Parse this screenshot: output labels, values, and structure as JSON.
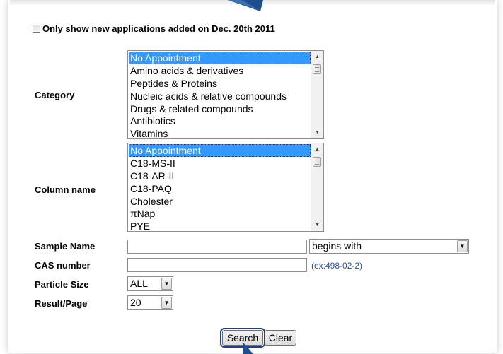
{
  "filter": {
    "new_only_label": "Only show new applications added on Dec. 20th 2011",
    "checked": false
  },
  "category": {
    "label": "Category",
    "options": [
      "No Appointment",
      "Amino acids & derivatives",
      "Peptides & Proteins",
      "Nucleic acids & relative compounds",
      "Drugs & related compounds",
      "Antibiotics",
      "Vitamins"
    ],
    "selected": "No Appointment"
  },
  "column": {
    "label": "Column name",
    "options": [
      "No Appointment",
      "C18-MS-II",
      "C18-AR-II",
      "C18-PAQ",
      "Cholester",
      "πNap",
      "PYE"
    ],
    "selected": "No Appointment"
  },
  "sample_name": {
    "label": "Sample Name",
    "value": "",
    "match_mode": "begins with"
  },
  "cas_number": {
    "label": "CAS number",
    "value": "",
    "hint": "(ex:498-02-2)"
  },
  "particle_size": {
    "label": "Particle Size",
    "value": "ALL"
  },
  "result_page": {
    "label": "Result/Page",
    "value": "20"
  },
  "buttons": {
    "search": "Search",
    "clear": "Clear"
  },
  "colors": {
    "selection": "#3399ff",
    "hint_link": "#2b4fa0",
    "pointer": "#1f4e8c"
  }
}
